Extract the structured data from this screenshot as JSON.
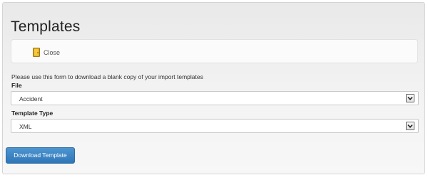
{
  "page": {
    "title": "Templates"
  },
  "toolbar": {
    "close_label": "Close",
    "close_icon": "close-door-icon"
  },
  "form": {
    "intro": "Please use this form to download a blank copy of your import templates",
    "file": {
      "label": "File",
      "value": "Accident"
    },
    "template_type": {
      "label": "Template Type",
      "value": "XML"
    },
    "download_label": "Download Template"
  },
  "colors": {
    "accent": "#337ab7",
    "panel_background": "#eeeeee"
  }
}
